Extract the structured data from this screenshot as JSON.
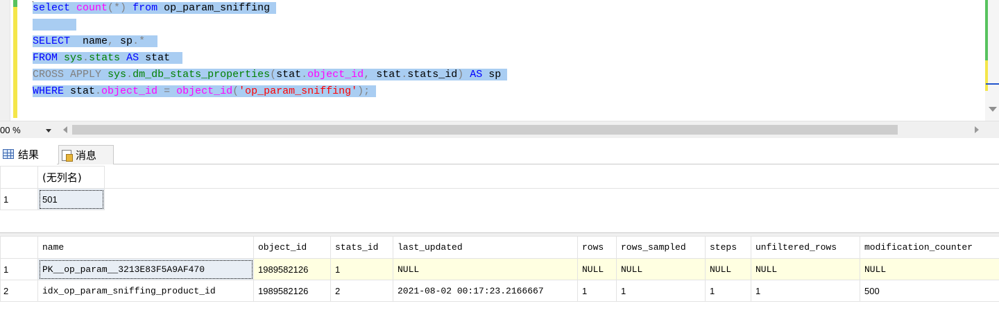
{
  "editor": {
    "lines": [
      {
        "selected": true,
        "tokens": [
          {
            "cls": "kw",
            "text": "select"
          },
          {
            "cls": "",
            "text": " "
          },
          {
            "cls": "fn",
            "text": "count"
          },
          {
            "cls": "gray",
            "text": "(*)"
          },
          {
            "cls": "",
            "text": " "
          },
          {
            "cls": "kw",
            "text": "from"
          },
          {
            "cls": "",
            "text": " op_param_sniffing "
          }
        ]
      },
      {
        "selected": true,
        "tokens": [
          {
            "cls": "",
            "text": "       "
          }
        ]
      },
      {
        "selected": true,
        "tokens": [
          {
            "cls": "kw",
            "text": "SELECT"
          },
          {
            "cls": "",
            "text": "  name"
          },
          {
            "cls": "gray",
            "text": ","
          },
          {
            "cls": "",
            "text": " sp"
          },
          {
            "cls": "gray",
            "text": ".*"
          },
          {
            "cls": "",
            "text": "  "
          }
        ]
      },
      {
        "selected": true,
        "tokens": [
          {
            "cls": "kw",
            "text": "FROM"
          },
          {
            "cls": "",
            "text": " "
          },
          {
            "cls": "grn",
            "text": "sys"
          },
          {
            "cls": "gray",
            "text": "."
          },
          {
            "cls": "grn",
            "text": "stats"
          },
          {
            "cls": "",
            "text": " "
          },
          {
            "cls": "kw",
            "text": "AS"
          },
          {
            "cls": "",
            "text": " stat  "
          }
        ]
      },
      {
        "selected": true,
        "tokens": [
          {
            "cls": "gray",
            "text": "CROSS APPLY"
          },
          {
            "cls": "",
            "text": " "
          },
          {
            "cls": "grn",
            "text": "sys"
          },
          {
            "cls": "gray",
            "text": "."
          },
          {
            "cls": "grn",
            "text": "dm_db_stats_properties"
          },
          {
            "cls": "gray",
            "text": "("
          },
          {
            "cls": "",
            "text": "stat"
          },
          {
            "cls": "gray",
            "text": "."
          },
          {
            "cls": "fn",
            "text": "object_id"
          },
          {
            "cls": "gray",
            "text": ","
          },
          {
            "cls": "",
            "text": " stat"
          },
          {
            "cls": "gray",
            "text": "."
          },
          {
            "cls": "",
            "text": "stats_id"
          },
          {
            "cls": "gray",
            "text": ")"
          },
          {
            "cls": "",
            "text": " "
          },
          {
            "cls": "kw",
            "text": "AS"
          },
          {
            "cls": "",
            "text": " sp "
          }
        ]
      },
      {
        "selected": true,
        "tokens": [
          {
            "cls": "kw",
            "text": "WHERE"
          },
          {
            "cls": "",
            "text": " stat"
          },
          {
            "cls": "gray",
            "text": "."
          },
          {
            "cls": "fn",
            "text": "object_id"
          },
          {
            "cls": "",
            "text": " "
          },
          {
            "cls": "gray",
            "text": "="
          },
          {
            "cls": "",
            "text": " "
          },
          {
            "cls": "fn",
            "text": "object_id"
          },
          {
            "cls": "gray",
            "text": "("
          },
          {
            "cls": "str",
            "text": "'op_param_sniffing'"
          },
          {
            "cls": "gray",
            "text": ");"
          },
          {
            "cls": "",
            "text": " "
          }
        ]
      }
    ]
  },
  "zoom": {
    "value": "00 %"
  },
  "tabs": {
    "results_label": "结果",
    "messages_label": "消息"
  },
  "grid1": {
    "columns": [
      "(无列名)"
    ],
    "rows": [
      {
        "num": "1",
        "cells": [
          "501"
        ]
      }
    ]
  },
  "grid2": {
    "columns": [
      "name",
      "object_id",
      "stats_id",
      "last_updated",
      "rows",
      "rows_sampled",
      "steps",
      "unfiltered_rows",
      "modification_counter"
    ],
    "rows": [
      {
        "num": "1",
        "cells": [
          "PK__op_param__3213E83F5A9AF470",
          "1989582126",
          "1",
          "NULL",
          "NULL",
          "NULL",
          "NULL",
          "NULL",
          "NULL"
        ]
      },
      {
        "num": "2",
        "cells": [
          "idx_op_param_sniffing_product_id",
          "1989582126",
          "2",
          "2021-08-02 00:17:23.2166667",
          "1",
          "1",
          "1",
          "1",
          "500"
        ]
      }
    ]
  },
  "colors": {
    "selection": "#a9cdf2",
    "keyword": "#0000ff",
    "function": "#ff00ff",
    "string": "#ff0000",
    "system": "#008000",
    "null_row": "#ffffe1"
  }
}
